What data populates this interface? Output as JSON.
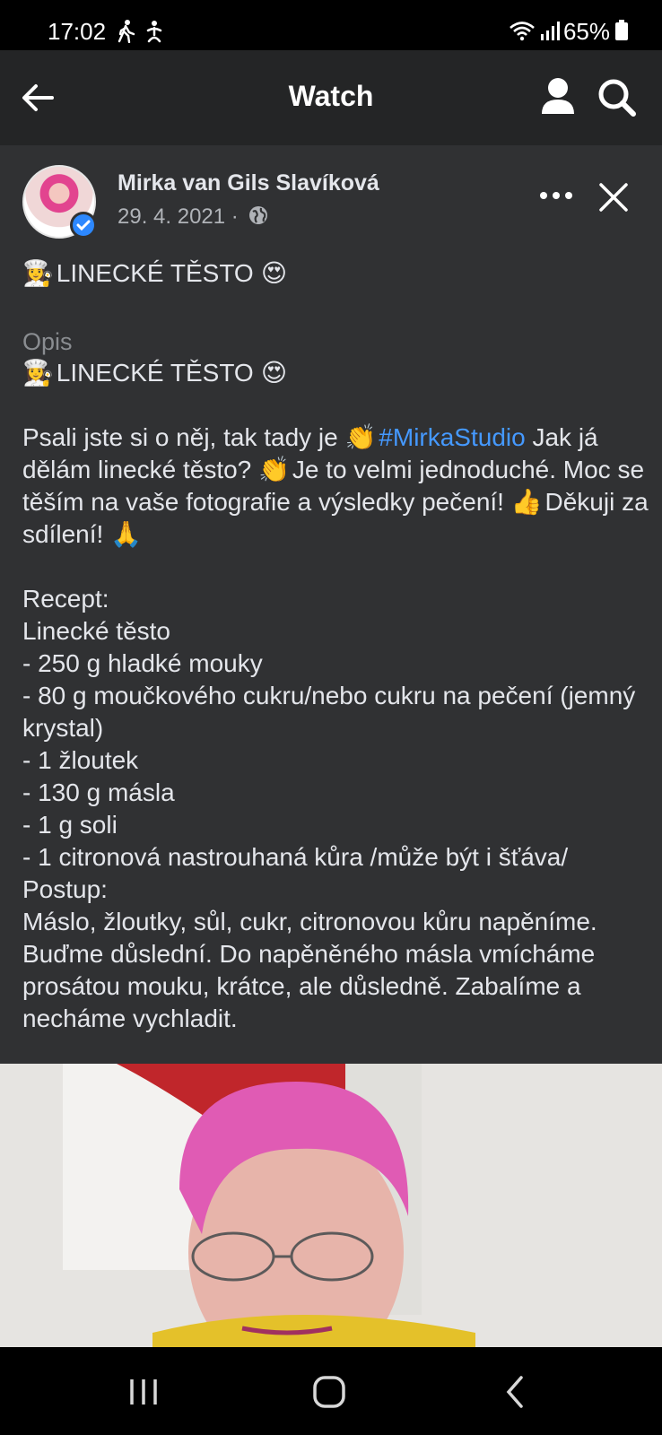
{
  "status_bar": {
    "time": "17:02",
    "battery": "65%"
  },
  "header": {
    "title": "Watch"
  },
  "post": {
    "author": "Mirka van Gils Slavíková",
    "date": "29. 4. 2021 ·",
    "headline": "LINECKÉ TĚSTO",
    "description_label": "Opis",
    "description_title": "LINECKÉ TĚSTO",
    "intro_part1": "Psali jste si o něj, tak tady je",
    "hashtag": "#MirkaStudio",
    "intro_part2": "Jak já dělám linecké těsto?",
    "intro_part3": "Je to velmi jednoduché. Moc se těším na vaše fotografie a výsledky pečení!",
    "intro_part4": "Děkuji za sdílení!",
    "recipe_label": "Recept:",
    "recipe_name": "Linecké těsto",
    "ingredients": [
      "- 250 g hladké mouky",
      "- 80 g moučkového cukru/nebo cukru na pečení (jemný krystal)",
      "- 1 žloutek",
      "- 130 g másla",
      "- 1 g soli",
      "- 1 citronová nastrouhaná kůra /může být i šťáva/"
    ],
    "method_label": "Postup:",
    "method_text": "Máslo, žloutky, sůl, cukr, citronovou kůru napěníme. Buďme důslední. Do napěněného másla vmícháme prosátou mouku, krátce, ale důsledně. Zabalíme a necháme vychladit."
  },
  "icons": {
    "back": "arrow-left-icon",
    "profile": "person-icon",
    "search": "search-icon",
    "more": "more-horizontal-icon",
    "close": "close-icon",
    "privacy": "globe-icon",
    "nav_recents": "recents-icon",
    "nav_home": "home-icon",
    "nav_back": "chevron-left-icon"
  },
  "colors": {
    "header_bg": "#242526",
    "post_bg": "#303133",
    "hashtag": "#4599ff",
    "verified": "#2d88ff"
  }
}
